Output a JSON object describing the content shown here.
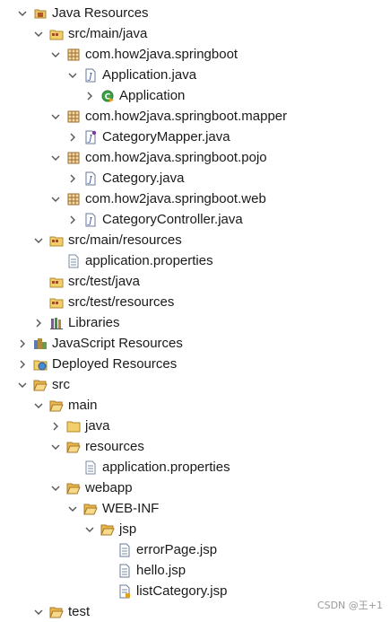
{
  "tree": [
    {
      "label": "Java Resources",
      "icon": "java-resources-icon",
      "expanded": true
    },
    {
      "label": "src/main/java",
      "icon": "source-folder-icon",
      "expanded": true
    },
    {
      "label": "com.how2java.springboot",
      "icon": "package-icon",
      "expanded": true
    },
    {
      "label": "Application.java",
      "icon": "java-file-icon",
      "expanded": true
    },
    {
      "label": "Application",
      "icon": "class-run-icon",
      "expanded": false
    },
    {
      "label": "com.how2java.springboot.mapper",
      "icon": "package-icon",
      "expanded": true
    },
    {
      "label": "CategoryMapper.java",
      "icon": "java-interface-file-icon",
      "expanded": false
    },
    {
      "label": "com.how2java.springboot.pojo",
      "icon": "package-icon",
      "expanded": true
    },
    {
      "label": "Category.java",
      "icon": "java-file-icon",
      "expanded": false
    },
    {
      "label": "com.how2java.springboot.web",
      "icon": "package-icon",
      "expanded": true
    },
    {
      "label": "CategoryController.java",
      "icon": "java-file-icon",
      "expanded": false
    },
    {
      "label": "src/main/resources",
      "icon": "source-folder-icon",
      "expanded": true
    },
    {
      "label": "application.properties",
      "icon": "properties-file-icon",
      "expanded": null
    },
    {
      "label": "src/test/java",
      "icon": "source-folder-icon",
      "expanded": null
    },
    {
      "label": "src/test/resources",
      "icon": "source-folder-icon",
      "expanded": null
    },
    {
      "label": "Libraries",
      "icon": "libraries-icon",
      "expanded": false
    },
    {
      "label": "JavaScript Resources",
      "icon": "javascript-resources-icon",
      "expanded": false
    },
    {
      "label": "Deployed Resources",
      "icon": "deployed-resources-icon",
      "expanded": false
    },
    {
      "label": "src",
      "icon": "folder-icon",
      "expanded": true
    },
    {
      "label": "main",
      "icon": "folder-icon",
      "expanded": true
    },
    {
      "label": "java",
      "icon": "folder-icon",
      "expanded": false
    },
    {
      "label": "resources",
      "icon": "folder-icon",
      "expanded": true
    },
    {
      "label": "application.properties",
      "icon": "properties-file-icon",
      "expanded": null
    },
    {
      "label": "webapp",
      "icon": "folder-icon",
      "expanded": true
    },
    {
      "label": "WEB-INF",
      "icon": "folder-icon",
      "expanded": true
    },
    {
      "label": "jsp",
      "icon": "folder-icon",
      "expanded": true
    },
    {
      "label": "errorPage.jsp",
      "icon": "jsp-file-icon",
      "expanded": null
    },
    {
      "label": "hello.jsp",
      "icon": "jsp-file-icon",
      "expanded": null
    },
    {
      "label": "listCategory.jsp",
      "icon": "jsp-file-icon",
      "expanded": null
    },
    {
      "label": "test",
      "icon": "folder-icon",
      "expanded": true
    }
  ],
  "watermark": "CSDN @王+1"
}
